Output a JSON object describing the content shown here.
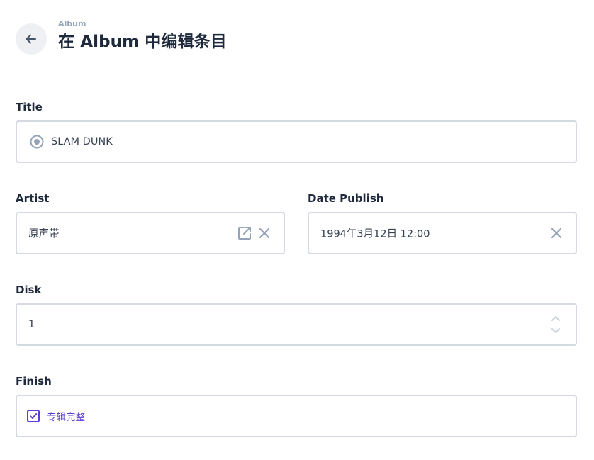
{
  "header": {
    "breadcrumb": "Album",
    "title": "在 Album 中编辑条目"
  },
  "fields": {
    "title": {
      "label": "Title",
      "value": "SLAM DUNK"
    },
    "artist": {
      "label": "Artist",
      "value": "原声带"
    },
    "date_publish": {
      "label": "Date Publish",
      "value": "1994年3月12日 12:00"
    },
    "disk": {
      "label": "Disk",
      "value": "1"
    },
    "finish": {
      "label": "Finish",
      "checkbox_label": "专辑完整",
      "checked": true
    }
  },
  "icons": {
    "back": "arrow-left-icon",
    "title_status": "radio-target-icon",
    "external_link": "external-link-icon",
    "clear": "close-icon",
    "stepper": "chevron-up-down-icon",
    "check": "checkmark-icon"
  },
  "colors": {
    "accent": "#5b3fd0",
    "icon_muted": "#94a3b8",
    "border": "#d5d9e2",
    "back_bg": "#eef0f4"
  }
}
